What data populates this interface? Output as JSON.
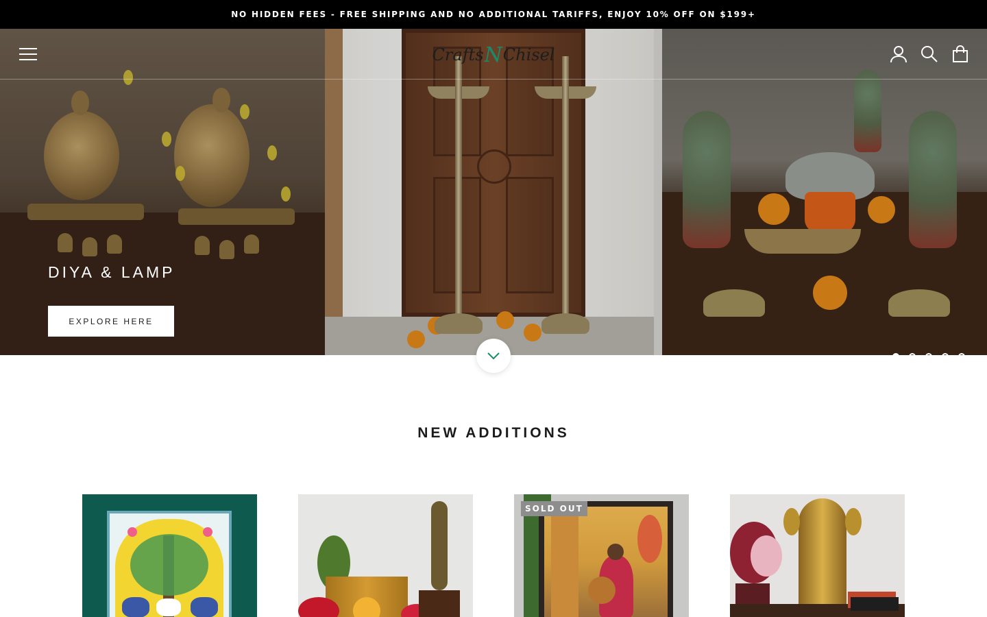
{
  "announcement": {
    "text": "NO HIDDEN FEES - FREE SHIPPING AND NO ADDITIONAL TARIFFS, ENJOY 10% OFF ON $199+"
  },
  "header": {
    "logo_part1": "Crafts",
    "logo_n": "N",
    "logo_part2": "Chisel",
    "icons": [
      "menu-icon",
      "account-icon",
      "search-icon",
      "cart-bag-icon"
    ]
  },
  "hero": {
    "slide_title": "DIYA & LAMP",
    "cta_label": "EXPLORE HERE",
    "slide_count": 5,
    "active_slide": 1
  },
  "new_additions": {
    "title": "NEW ADDITIONS",
    "products": [
      {
        "name": "tree-of-life-painting",
        "badge": ""
      },
      {
        "name": "tulsi-planter-and-krishna",
        "badge": ""
      },
      {
        "name": "lady-with-veena-painting",
        "badge": "SOLD OUT"
      },
      {
        "name": "brass-deity-idol",
        "badge": ""
      }
    ]
  },
  "colors": {
    "accent": "#1a8a6a",
    "announcement_bg": "#000000",
    "badge_bg": "#8d8d8d"
  }
}
